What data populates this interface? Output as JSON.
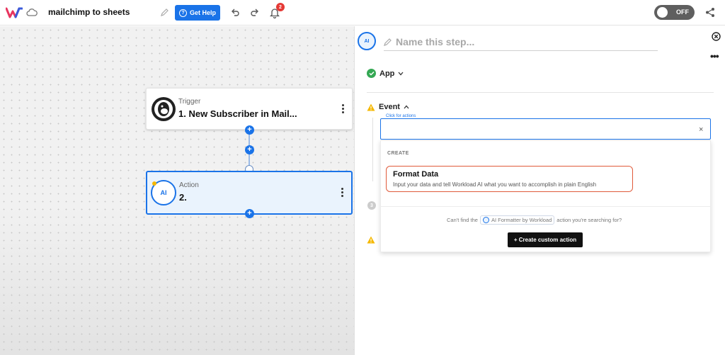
{
  "header": {
    "flow_title": "mailchimp to sheets",
    "help_label": "Get Help",
    "notification_count": "2",
    "toggle_label": "OFF"
  },
  "canvas": {
    "trigger": {
      "subtitle": "Trigger",
      "title": "1. New Subscriber in Mail..."
    },
    "action": {
      "subtitle": "Action",
      "title": "2.",
      "icon_text": "AI"
    }
  },
  "panel": {
    "icon_text": "AI",
    "name_placeholder": "Name this step...",
    "app_label": "App",
    "event_label": "Event",
    "field_label": "Click for actions",
    "field_clear": "×",
    "step_number": "3",
    "dropdown": {
      "section_label": "CREATE",
      "option_title": "Format Data",
      "option_desc": "Input your data and tell Workload AI what you want to accomplish in plain English",
      "cant_find_prefix": "Can't find the",
      "cant_find_app": "AI Formatter by Workload",
      "cant_find_suffix": "action you're searching for?",
      "custom_button": "+ Create custom action"
    }
  },
  "colors": {
    "accent": "#1a73e8",
    "success": "#34a853",
    "warning": "#f5b800",
    "highlight": "#e05a3a",
    "badge": "#e53935"
  }
}
